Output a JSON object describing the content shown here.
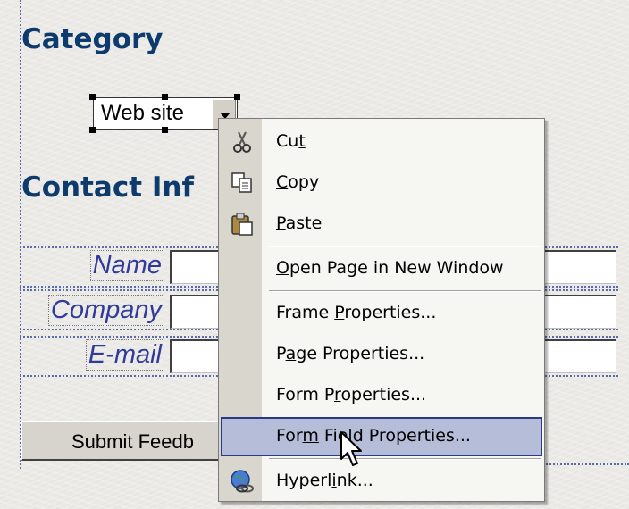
{
  "headings": {
    "category": "Category",
    "contact": "Contact Inf"
  },
  "category_select": {
    "value": "Web site"
  },
  "form": {
    "fields": [
      {
        "label": "Name"
      },
      {
        "label": "Company"
      },
      {
        "label": "E-mail"
      }
    ],
    "submit_label": "Submit Feedb"
  },
  "context_menu": {
    "items": [
      {
        "pre": "Cu",
        "acc": "t",
        "post": "",
        "icon": "cut-icon"
      },
      {
        "pre": "",
        "acc": "C",
        "post": "opy",
        "icon": "copy-icon"
      },
      {
        "pre": "",
        "acc": "P",
        "post": "aste",
        "icon": "paste-icon"
      },
      {
        "pre": "",
        "acc": "O",
        "post": "pen Page in New Window",
        "icon": ""
      },
      {
        "pre": "Frame ",
        "acc": "P",
        "post": "roperties...",
        "icon": ""
      },
      {
        "pre": "P",
        "acc": "a",
        "post": "ge Properties...",
        "icon": ""
      },
      {
        "pre": "Form P",
        "acc": "r",
        "post": "operties...",
        "icon": ""
      },
      {
        "pre": "For",
        "acc": "m",
        "post": " Field Properties...",
        "icon": ""
      },
      {
        "pre": "Hyperl",
        "acc": "i",
        "post": "nk...",
        "icon": "hyperlink-icon"
      }
    ],
    "highlighted_index": 7
  }
}
